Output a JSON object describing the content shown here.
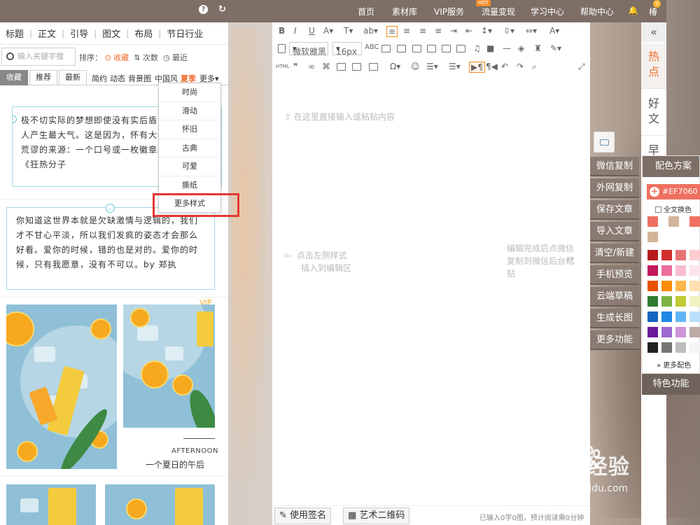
{
  "topnav": {
    "help_icon": "help-icon",
    "refresh_icon": "refresh-icon",
    "items": [
      "首页",
      "素材库",
      "VIP服务",
      "流量变现",
      "学习中心",
      "帮助中心"
    ],
    "hot_badge": "HOT",
    "user_initial": "椿",
    "vip_badge": "V"
  },
  "left": {
    "categories": [
      "标题",
      "正文",
      "引导",
      "图文",
      "布局",
      "节日行业"
    ],
    "search_placeholder": "输入关键字搜",
    "sort_label": "排序：",
    "sort_options": [
      "收藏",
      "次数",
      "最近"
    ],
    "tabs": [
      "收藏",
      "推荐",
      "最新"
    ],
    "subtabs": [
      "简约",
      "动态",
      "背景图",
      "中国风",
      "夏季",
      "更多"
    ],
    "card1_text": "极不切实际的梦想即使没有实后盾，一样可以让人产生最大气。这是因为，怀有大希望者以有最荒谬的来源：一个口号或一枚徽章。 from 《狂热分子",
    "card2_text": "你知道这世界本就是欠缺激情与逻辑的，我们才不甘心平淡，所以我们发疯的姿态才会那么好看。爱你的时候，错的也是对的。爱你的时候，只有我愿意，没有不可以。by 郑执",
    "vip_label": "VIP",
    "afternoon_en": "AFTERNOON",
    "afternoon_cn": "一个夏日的午后"
  },
  "dropdown": {
    "items": [
      "时尚",
      "滑动",
      "怀旧",
      "古典",
      "可爱",
      "撕纸"
    ],
    "more": "更多样式"
  },
  "editor": {
    "font_name": "微软雅黑",
    "font_size": "16px",
    "hint_top": "在这里直接输入或粘贴内容",
    "hint_left": "点击左侧样式插入到编辑区",
    "hint_right": "编辑完成后点微信复制到微信后台粘贴",
    "bottom_buttons": [
      "使用签名",
      "艺术二维码"
    ],
    "status": "已输入0字0图，预计阅读需0分钟"
  },
  "actions": [
    "微信复制",
    "外网复制",
    "保存文章",
    "导入文章",
    "清空/新建",
    "手机预览",
    "云端草稿",
    "生成长图",
    "更多功能"
  ],
  "right_tabs": [
    "热点",
    "好文",
    "早资"
  ],
  "color_panel": {
    "title": "配色方案",
    "current": "#EF7060",
    "fulltext": "全文换色",
    "more": "更多配色",
    "recent": [
      "#ef7060",
      "#d4b59a",
      "#ef7060",
      "#d4b59a"
    ],
    "grid": [
      [
        "#b71c1c",
        "#d32f2f",
        "#e57373",
        "#ffcdd2"
      ],
      [
        "#c2185b",
        "#ec6d9b",
        "#f8bbd0",
        "#fce4ec"
      ],
      [
        "#e65100",
        "#fb8c00",
        "#ffb74d",
        "#ffe0b2"
      ],
      [
        "#2e7d32",
        "#7cb342",
        "#c0ca33",
        "#f0f4c3"
      ],
      [
        "#1565c0",
        "#1e88e5",
        "#64b5f6",
        "#bbdefb"
      ],
      [
        "#6a1b9a",
        "#9c6ad1",
        "#ce93d8",
        "#bcaaa4"
      ],
      [
        "#212121",
        "#757575",
        "#bdbdbd",
        "#f5f5f5"
      ]
    ]
  },
  "special": "特色功能",
  "watermark": {
    "logo": "Bai 经验",
    "url": "jingyan.baidu.com"
  }
}
